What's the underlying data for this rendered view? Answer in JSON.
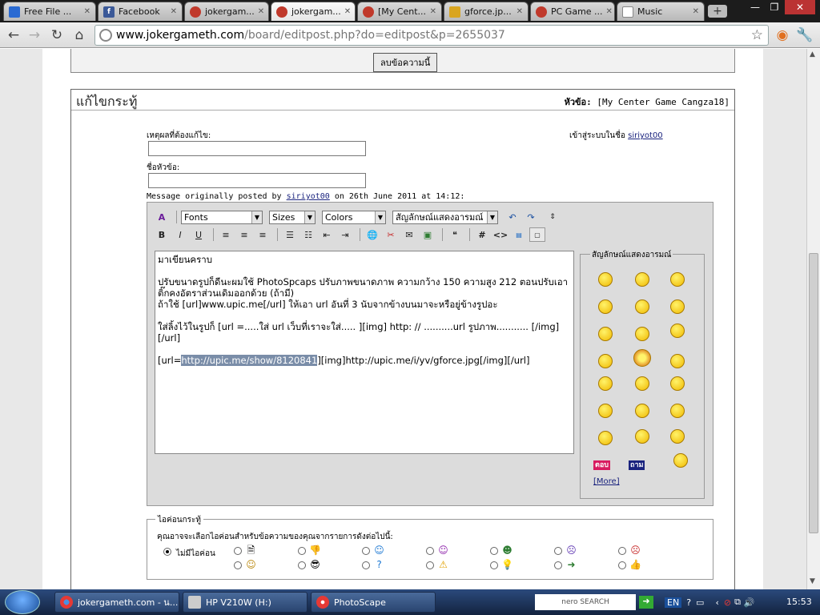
{
  "browser": {
    "tabs": [
      {
        "label": "Free File ...",
        "icon": "free-file-favicon"
      },
      {
        "label": "Facebook",
        "icon": "facebook-favicon"
      },
      {
        "label": "jokergam...",
        "icon": "jokergame-favicon"
      },
      {
        "label": "jokergam...",
        "icon": "jokergame-favicon"
      },
      {
        "label": "[My Cent...",
        "icon": "jokergame-favicon"
      },
      {
        "label": "gforce.jp...",
        "icon": "image-favicon"
      },
      {
        "label": "PC Game ...",
        "icon": "jokergame-favicon"
      },
      {
        "label": "Music",
        "icon": "page-favicon"
      }
    ],
    "new_tab": "+",
    "url_host": "www.jokergameth.com",
    "url_path": "/board/editpost.php?do=editpost&p=2655037"
  },
  "page": {
    "delete_button": "ลบข้อความนี้",
    "panel_title": "แก้ไขกระทู้",
    "topic_label": "หัวข้อ:",
    "topic_value": "[My Center Game Cangza18]",
    "reason_label": "เหตุผลที่ต้องแก้ไข:",
    "reason_value": "",
    "title_label": "ชื่อหัวข้อ:",
    "title_value": "",
    "logged_in_label": "เข้าสู่ระบบในชื่อ",
    "logged_in_user": "siriyot00",
    "orig_prefix": "Message originally posted by",
    "orig_user": "siriyot00",
    "orig_suffix": "on 26th June 2011 at 14:12:",
    "editor": {
      "fonts": "Fonts",
      "sizes": "Sizes",
      "colors": "Colors",
      "smilies_select": "สัญลักษณ์แสดงอารมณ์",
      "line1": "มาเขียนคราบ",
      "line2": "ปรับขนาดรูปก็ดีนะผมใช้ PhotoSpcaps ปรับภาพขนาดภาพ ความกว้าง 150 ความสูง 212 ตอนปรับเอาติ๊กคงอัตราส่วนเดิมออกด้วย (ถ้ามี)\nถ้าใช้ [url]www.upic.me[/url] ให้เอา url อันที่ 3 นับจากข้างบนมาจะหรือยู่ข้างรูปอะ",
      "line3": "ใส่ลิ้งไว้ในรูปก็ [url =.....ใส่ url เว็บที่เราจะใส่..... ][img] http: // ..........url รูปภาพ........... [/img] [/url]",
      "line4_pre": "[url=",
      "line4_hl": "http://upic.me/show/8120841",
      "line4_post": "][img]http://upic.me/i/yv/gforce.jpg[/img][/url]"
    },
    "smilies": {
      "legend": "สัญลักษณ์แสดงอารมณ์",
      "tag1": "ตอบ",
      "tag2": "ถาม",
      "more": "[More]"
    },
    "post_icons": {
      "legend": "ไอค่อนกระทู้",
      "instruction": "คุณอาจจะเลือกไอค่อนสำหรับข้อความของคุณจากรายการดังต่อไปนี้:",
      "no_icon": "ไม่มีไอค่อน"
    }
  },
  "taskbar": {
    "tasks": [
      "jokergameth.com - น...",
      "HP V210W (H:)",
      "PhotoScape"
    ],
    "search_brand": "nero SEARCH",
    "lang": "EN",
    "clock": "15:53"
  },
  "colors": {
    "highlight": "#7a8da8",
    "editor_bg": "#dcdcdc",
    "taskbar": "#2b4a7c"
  }
}
